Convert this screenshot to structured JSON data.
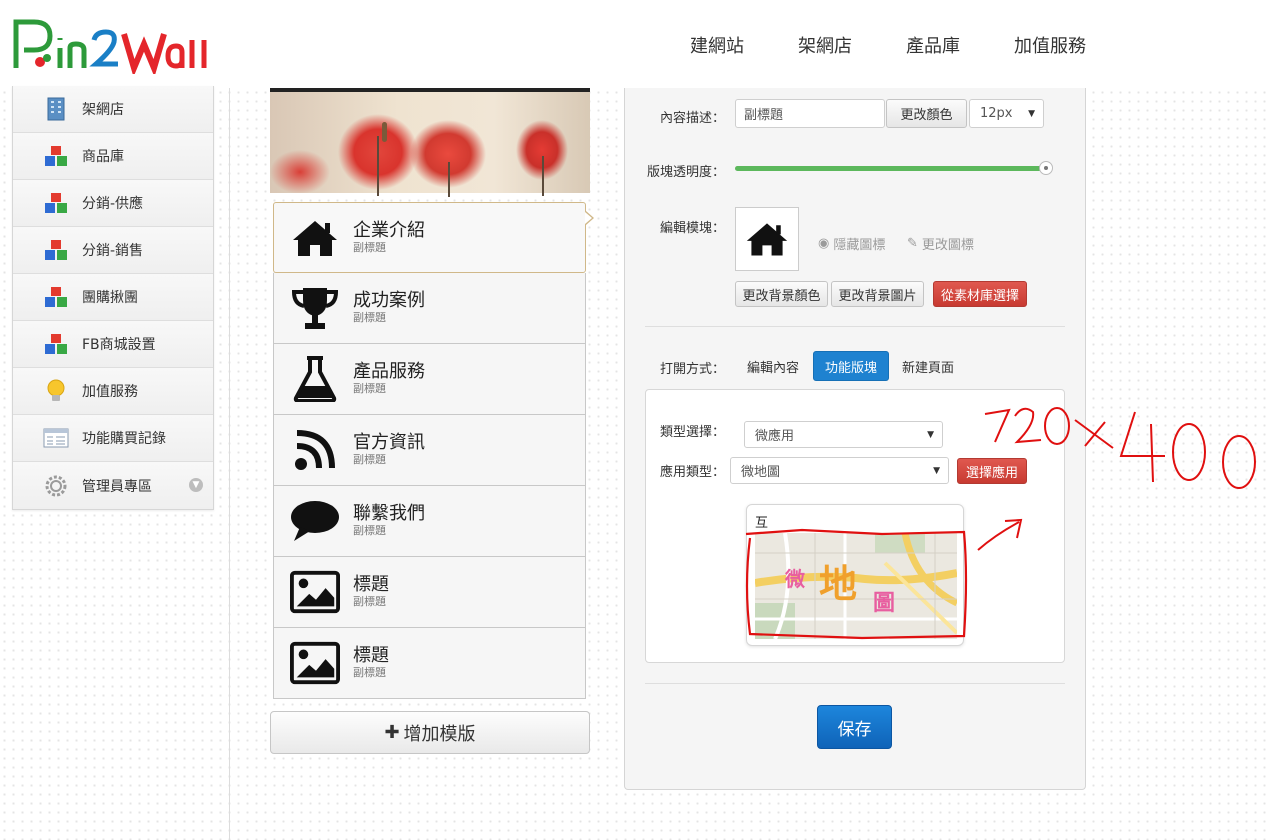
{
  "header": {
    "logo_text": "Pin2Wall",
    "nav": [
      "建網站",
      "架網店",
      "產品庫",
      "加值服務"
    ]
  },
  "sidebar": {
    "items": [
      {
        "label": "架網店",
        "icon": "building-icon"
      },
      {
        "label": "商品庫",
        "icon": "blocks-icon"
      },
      {
        "label": "分銷-供應",
        "icon": "blocks-icon"
      },
      {
        "label": "分銷-銷售",
        "icon": "blocks-icon"
      },
      {
        "label": "團購揪團",
        "icon": "blocks-icon"
      },
      {
        "label": "FB商城設置",
        "icon": "blocks-icon"
      },
      {
        "label": "加值服務",
        "icon": "lightbulb-icon"
      },
      {
        "label": "功能購買記錄",
        "icon": "list-window-icon"
      },
      {
        "label": "管理員專區",
        "icon": "gear-icon"
      }
    ]
  },
  "menu": {
    "items": [
      {
        "title": "企業介紹",
        "subtitle": "副標題",
        "icon": "home-icon"
      },
      {
        "title": "成功案例",
        "subtitle": "副標題",
        "icon": "trophy-icon"
      },
      {
        "title": "產品服務",
        "subtitle": "副標題",
        "icon": "flask-icon"
      },
      {
        "title": "官方資訊",
        "subtitle": "副標題",
        "icon": "rss-icon"
      },
      {
        "title": "聯繫我們",
        "subtitle": "副標題",
        "icon": "comment-icon"
      },
      {
        "title": "標題",
        "subtitle": "副標題",
        "icon": "image-icon"
      },
      {
        "title": "標題",
        "subtitle": "副標題",
        "icon": "image-icon"
      }
    ],
    "add_label": "增加模版"
  },
  "editor": {
    "desc_label": "內容描述：",
    "desc_value": "副標題",
    "change_color": "更改顏色",
    "font_size": "12px",
    "opacity_label": "版塊透明度：",
    "opacity_value": 1.0,
    "edit_block_label": "編輯模塊：",
    "hide_icon": "隱藏圖標",
    "change_icon": "更改圖標",
    "change_bg_color": "更改背景顏色",
    "change_bg_image": "更改背景圖片",
    "from_material": "從素材庫選擇",
    "open_mode_label": "打開方式：",
    "tabs": [
      "編輯內容",
      "功能版塊",
      "新建頁面"
    ],
    "active_tab": "功能版塊",
    "type_select_label": "類型選擇：",
    "type_select_value": "微應用",
    "app_type_label": "應用類型：",
    "app_type_value": "微地圖",
    "select_app": "選擇應用",
    "map_card_title": "互",
    "map_text_1": "微",
    "map_text_2": "地",
    "map_text_3": "圖",
    "save": "保存"
  },
  "annotation": {
    "text": "720x400",
    "color": "#e01010"
  }
}
